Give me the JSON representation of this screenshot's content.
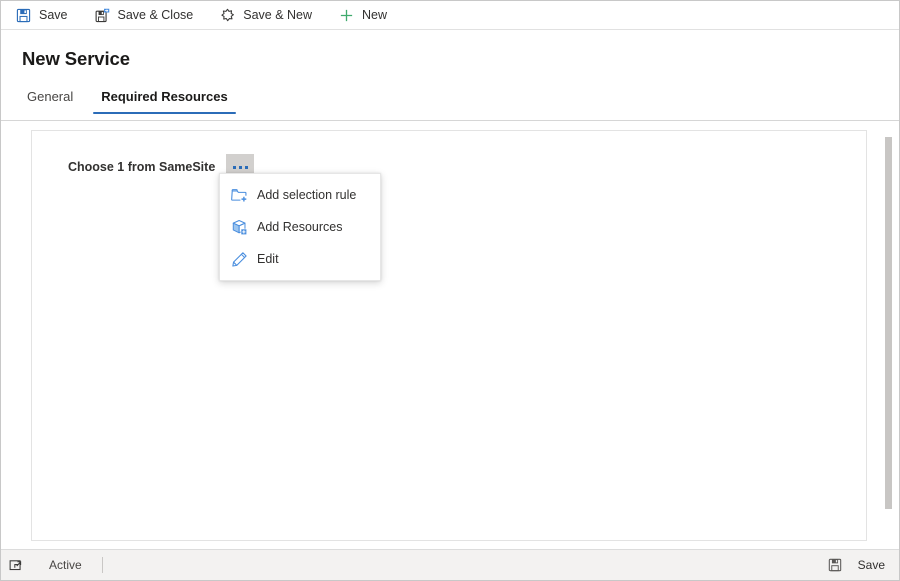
{
  "command_bar": {
    "buttons": [
      {
        "label": "Save",
        "icon": "save-floppy-icon"
      },
      {
        "label": "Save & Close",
        "icon": "save-and-close-icon"
      },
      {
        "label": "Save & New",
        "icon": "save-and-new-icon"
      },
      {
        "label": "New",
        "icon": "plus-icon"
      }
    ]
  },
  "header": {
    "title": "New Service",
    "tabs": [
      {
        "label": "General",
        "active": false
      },
      {
        "label": "Required Resources",
        "active": true
      }
    ]
  },
  "form": {
    "field_label": "Choose 1 from SameSite",
    "ellipsis_button_name": "More commands"
  },
  "context_menu": {
    "items": [
      {
        "label": "Add selection rule",
        "icon": "folder-add-icon"
      },
      {
        "label": "Add Resources",
        "icon": "box-add-icon"
      },
      {
        "label": "Edit",
        "icon": "pencil-icon"
      }
    ]
  },
  "status_bar": {
    "expand_icon": "popout-expand-icon",
    "state": "Active",
    "save_label": "Save",
    "save_icon": "save-floppy-icon"
  },
  "colors": {
    "accent_blue": "#2b6cb8",
    "icon_blue": "#4a8ede",
    "new_green": "#3faa6d",
    "dark_icon": "#3b3a39",
    "text_primary": "#201f1e",
    "text_secondary": "#484644",
    "status_bar_bg": "#f3f2f1",
    "ellipsis_btn_bg": "#d2d0ce",
    "scrollbar_thumb": "#c8c6c4"
  }
}
